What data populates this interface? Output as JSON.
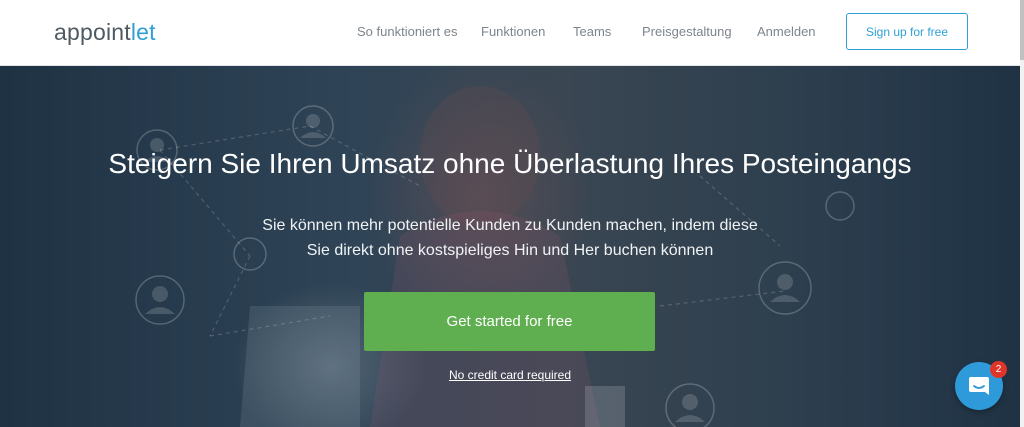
{
  "header": {
    "logo_main": "appoint",
    "logo_accent": "let",
    "nav": [
      {
        "label": "So funktioniert es"
      },
      {
        "label": "Funktionen"
      },
      {
        "label": "Teams"
      },
      {
        "label": "Preisgestaltung"
      },
      {
        "label": "Anmelden"
      }
    ],
    "signup_label": "Sign up for free"
  },
  "hero": {
    "title": "Steigern Sie Ihren Umsatz ohne Überlastung Ihres Posteingangs",
    "subtitle_line1": "Sie können mehr potentielle Kunden zu Kunden machen, indem diese",
    "subtitle_line2": "Sie direkt ohne kostspieliges Hin und Her buchen können",
    "cta_label": "Get started for free",
    "no_credit_card": "No credit card required"
  },
  "chat": {
    "badge_count": "2",
    "icon": "chat-icon"
  },
  "colors": {
    "accent": "#2f9fd6",
    "cta": "#5fae4f",
    "badge": "#e0352b"
  }
}
